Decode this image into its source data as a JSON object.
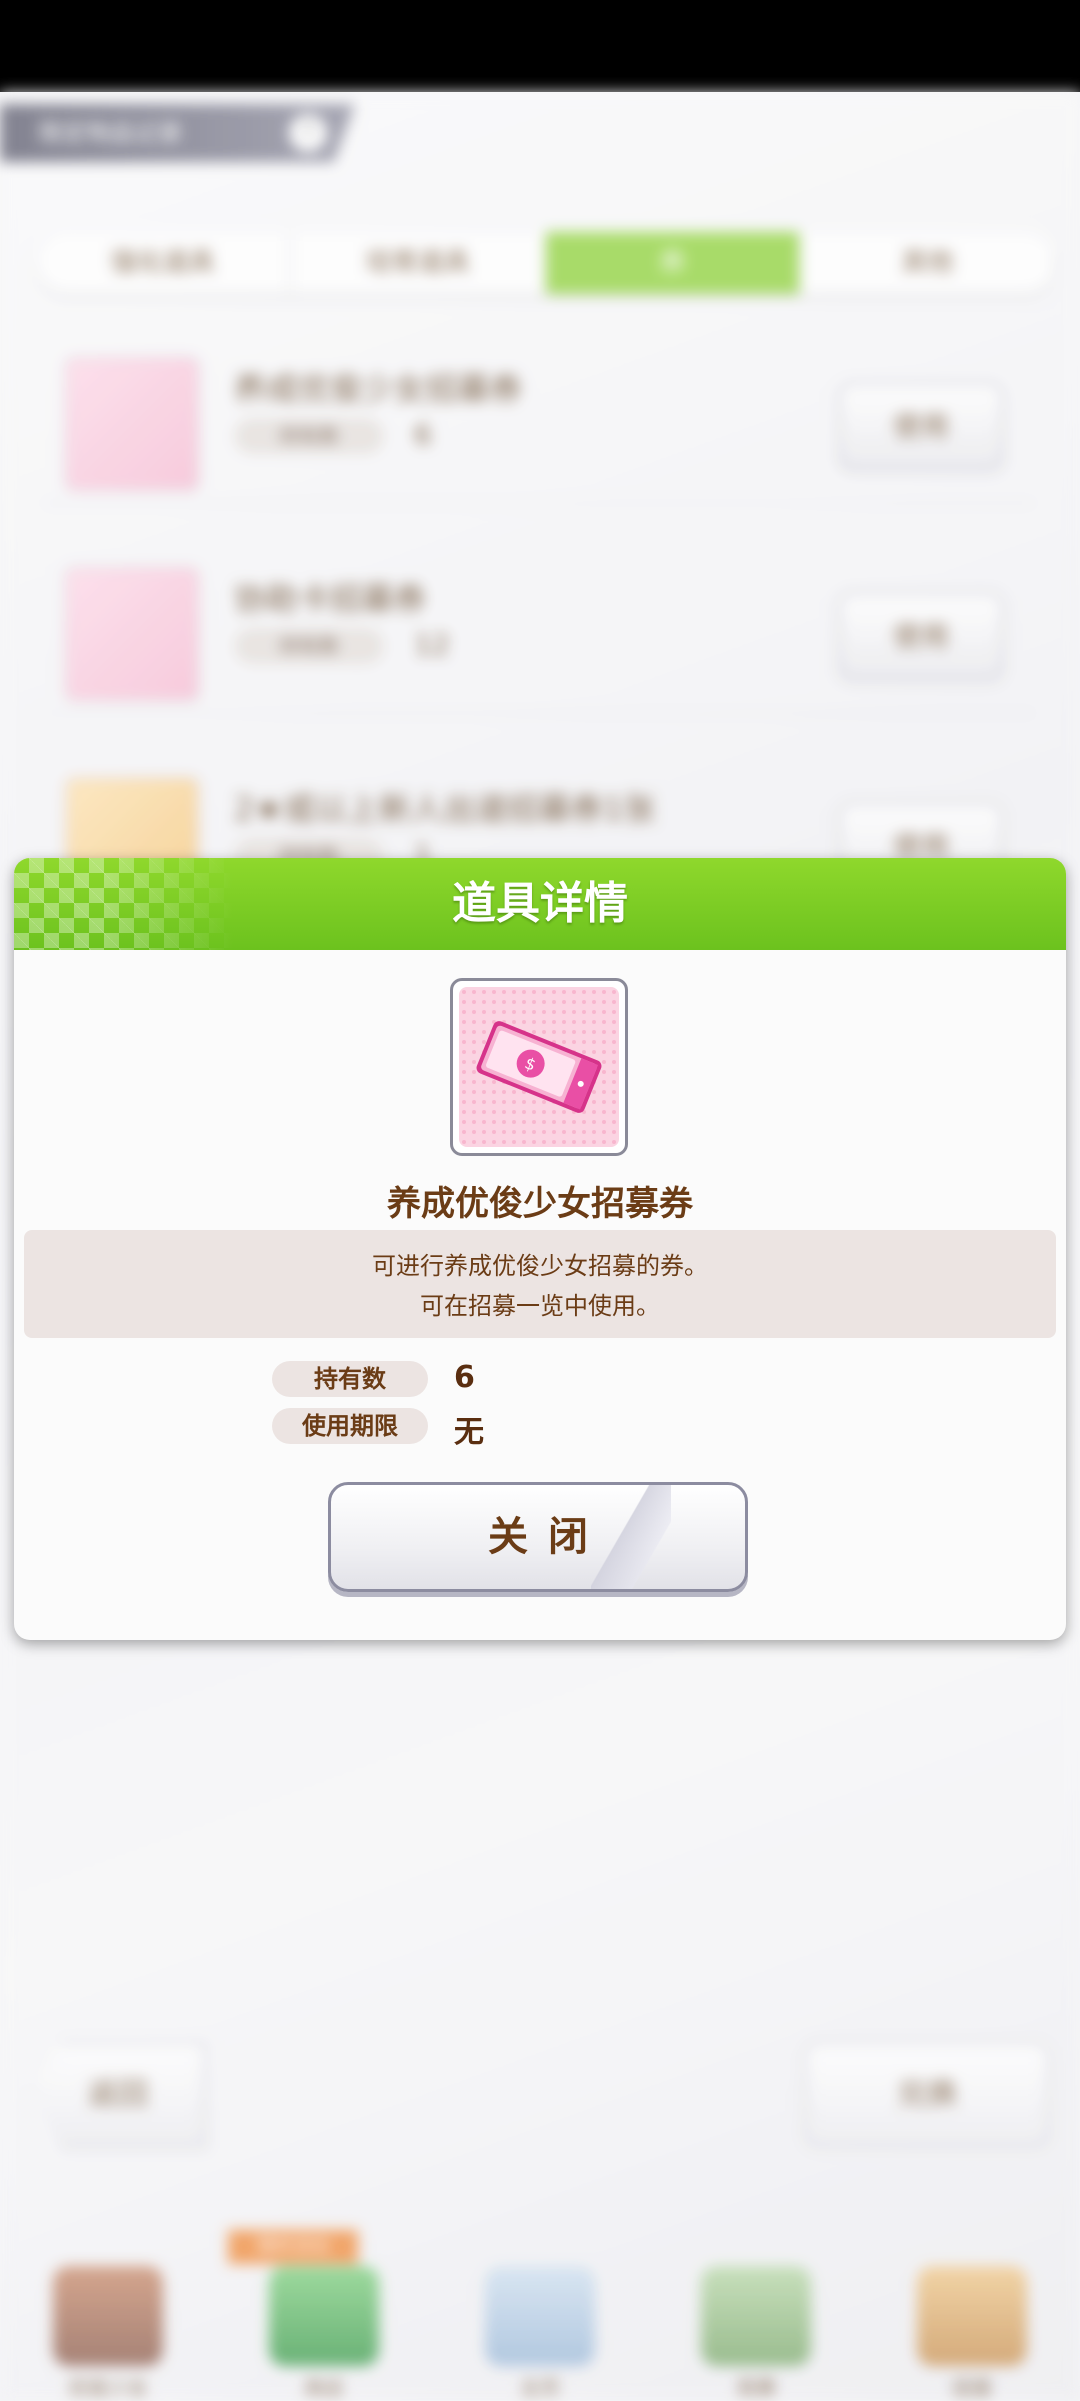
{
  "background": {
    "title_tag": "限定物品记录",
    "title_help": "?",
    "tabs": [
      "强化道具",
      "培育道具",
      "券",
      "其他"
    ],
    "active_tab_index": 2,
    "items": [
      {
        "name": "养成优俊少女招募券",
        "pill": "持有数",
        "count": "6",
        "button": "使用"
      },
      {
        "name": "协助卡招募券",
        "pill": "持有数",
        "count": "12",
        "button": "使用"
      },
      {
        "name": "2★或以上新人出道招募券1张",
        "pill": "持有数",
        "count": "1",
        "button": "使用"
      }
    ],
    "back_label": "返回",
    "exchange_label": "兑换",
    "nav": [
      "优俊少女",
      "商店",
      "主页",
      "竞赛",
      "扭蛋"
    ],
    "nav_badge": "限时活动"
  },
  "dialog": {
    "title": "道具详情",
    "item_name": "养成优俊少女招募券",
    "description_line1": "可进行养成优俊少女招募的券。",
    "description_line2": "可在招募一览中使用。",
    "owned_label": "持有数",
    "owned_value": "6",
    "expiry_label": "使用期限",
    "expiry_value": "无",
    "close_label": "关闭"
  },
  "colors": {
    "header_green": "#7acb24",
    "text_brown": "#6b3c16",
    "ticket_pink": "#e94fa5"
  }
}
